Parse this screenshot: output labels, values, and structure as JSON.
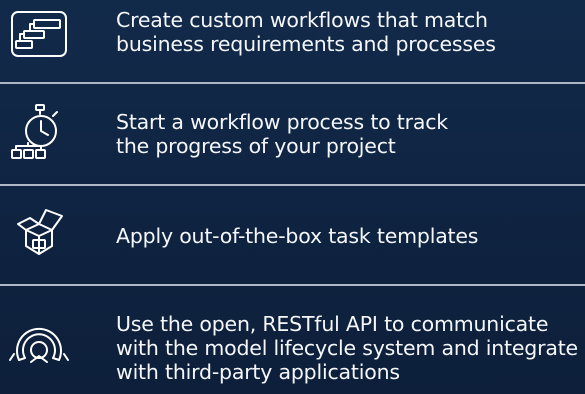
{
  "features": [
    {
      "icon": "workflow-diagram-icon",
      "lines": [
        "Create custom workflows that match",
        "business requirements and processes"
      ]
    },
    {
      "icon": "stopwatch-process-icon",
      "lines": [
        "Start a workflow process to track",
        "the progress of your project"
      ]
    },
    {
      "icon": "open-box-icon",
      "lines": [
        "Apply out-of-the-box task templates"
      ]
    },
    {
      "icon": "api-connector-icon",
      "lines": [
        "Use the open, RESTful API to communicate",
        "with the model lifecycle system and integrate",
        "with third-party applications"
      ]
    }
  ],
  "colors": {
    "background": "#112747",
    "text": "#f5f7fa",
    "divider": "#aeb8c6",
    "icon_stroke": "#ffffff"
  }
}
